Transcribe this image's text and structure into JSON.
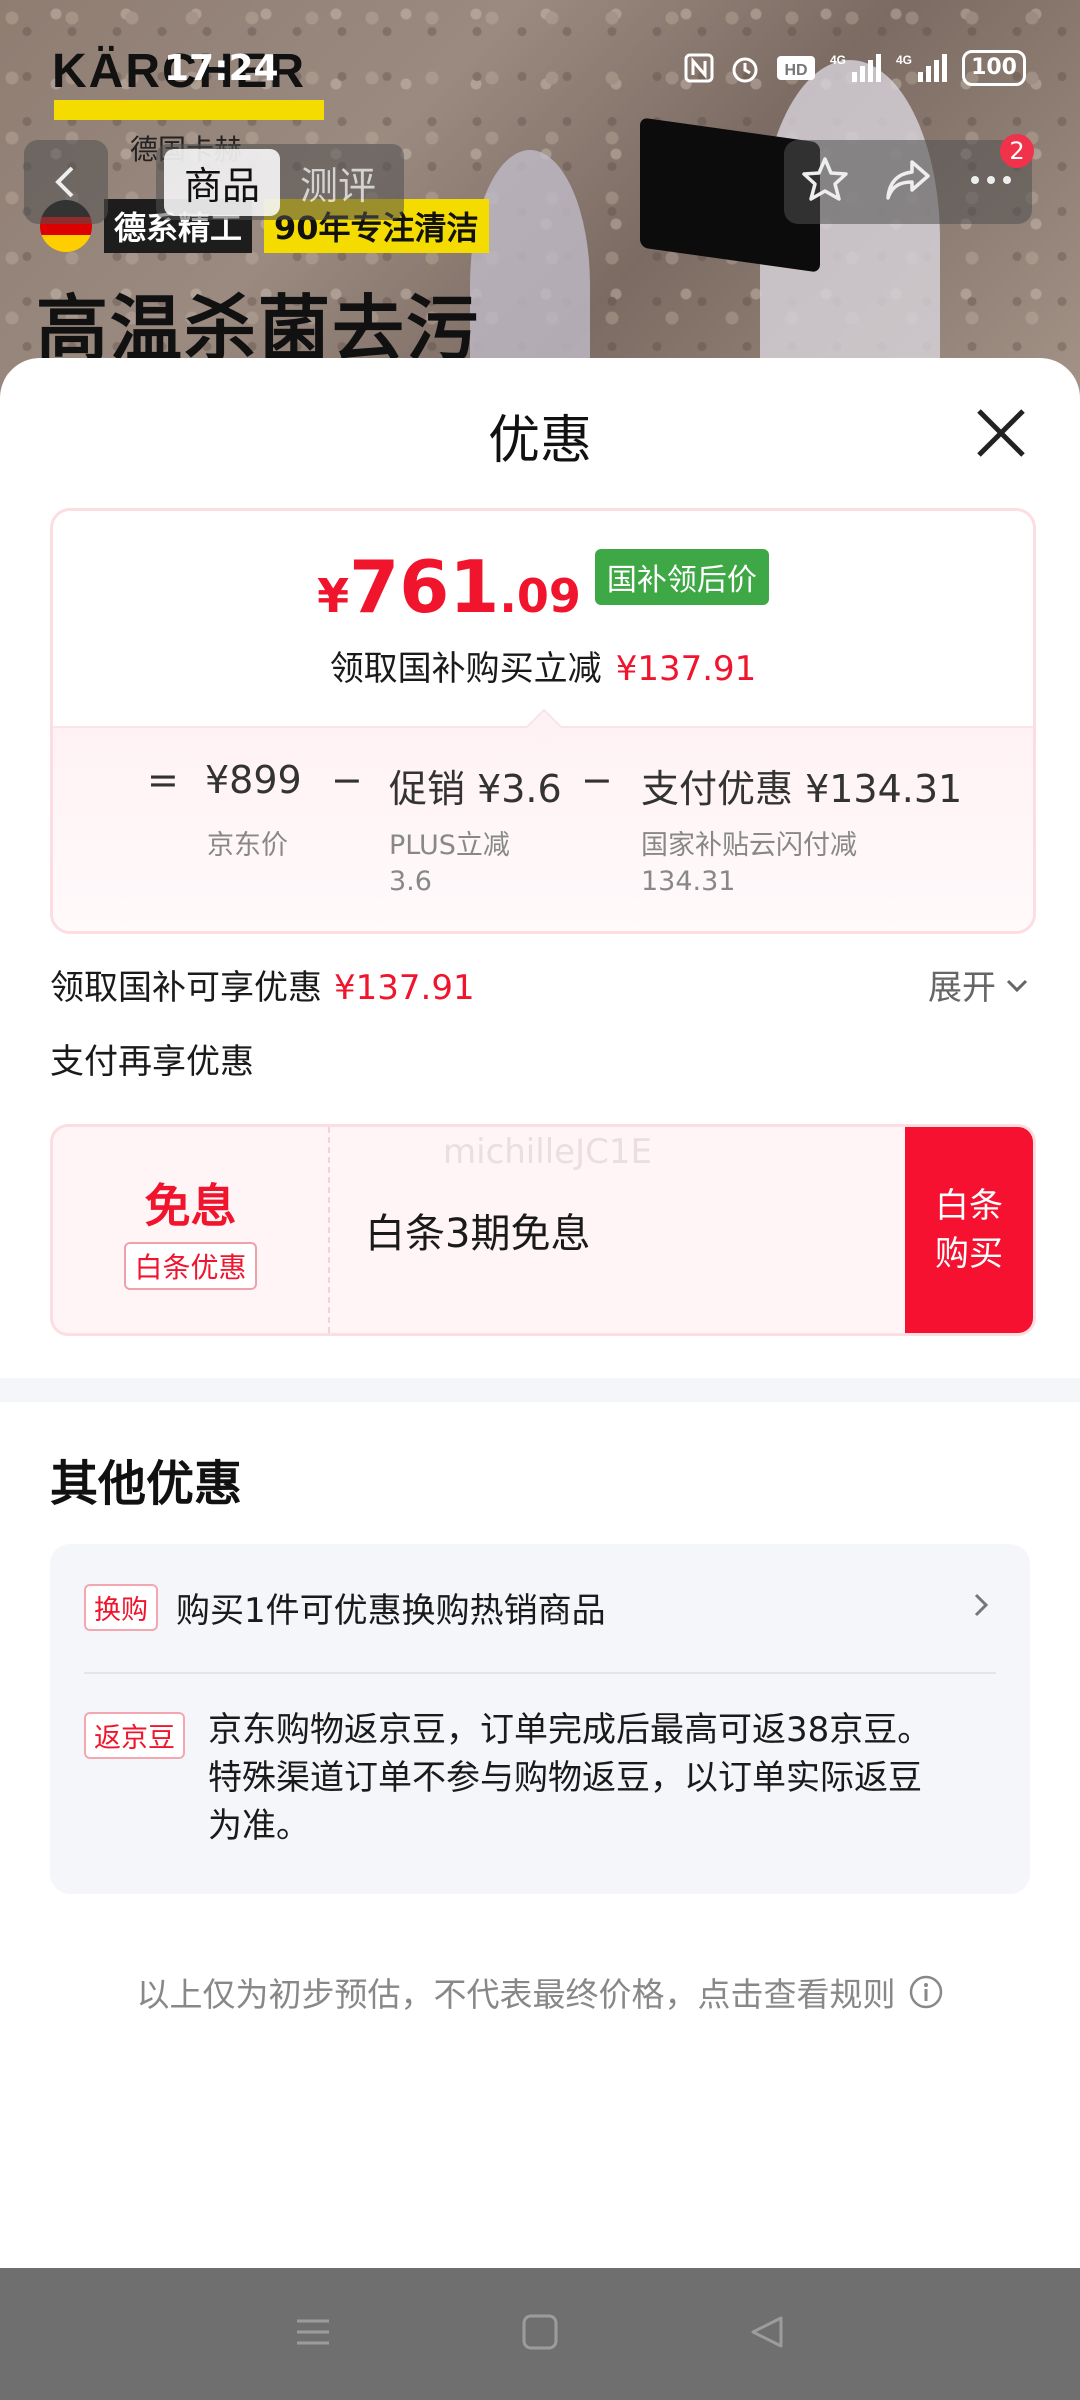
{
  "status_bar": {
    "time": "17:24",
    "icons": [
      "nfc-icon",
      "alarm-icon",
      "hd-icon",
      "signal-4g-icon",
      "signal-4g-icon"
    ],
    "battery": "100"
  },
  "hero": {
    "brand": "KÄRCHER",
    "brand_sub": "德国卡赫",
    "tag_left": "德系精工",
    "tag_right": "90年专注清洁",
    "title": "高温杀菌去污"
  },
  "nav": {
    "tabs": [
      {
        "label": "商品",
        "active": true
      },
      {
        "label": "测评",
        "active": false
      }
    ],
    "badge_count": "2"
  },
  "sheet": {
    "title": "优惠",
    "price": {
      "yen": "¥",
      "integer": "761",
      "decimal": ".09",
      "tag": "国补领后价",
      "sub_label": "领取国补购买立减",
      "sub_value": "¥137.91"
    },
    "breakdown": {
      "eq": "=",
      "base_value": "¥899",
      "base_label": "京东价",
      "minus1": "−",
      "promo_value": "促销 ¥3.6",
      "promo_label": "PLUS立减",
      "promo_label_value": "3.6",
      "minus2": "−",
      "pay_value": "支付优惠 ¥134.31",
      "pay_label": "国家补贴云闪付减",
      "pay_label_value": "134.31"
    },
    "coupon": {
      "label": "领取国补可享优惠",
      "value": "¥137.91",
      "expand": "展开"
    },
    "pay_section_label": "支付再享优惠",
    "pay_offer": {
      "big": "免息",
      "small": "白条优惠",
      "desc": "白条3期免息",
      "watermark": "michilleJC1E",
      "button_line1": "白条",
      "button_line2": "购买"
    },
    "other": {
      "title": "其他优惠",
      "items": [
        {
          "tag": "换购",
          "text": "购买1件可优惠换购热销商品"
        },
        {
          "tag": "返京豆",
          "text": "京东购物返京豆，订单完成后最高可返38京豆。特殊渠道订单不参与购物返豆，以订单实际返豆为准。"
        }
      ]
    },
    "footnote": "以上仅为初步预估，不代表最终价格，点击查看规则"
  },
  "colors": {
    "accent_red": "#f0152c",
    "green_tag": "#3fa846",
    "brand_yellow": "#f4dc00"
  }
}
